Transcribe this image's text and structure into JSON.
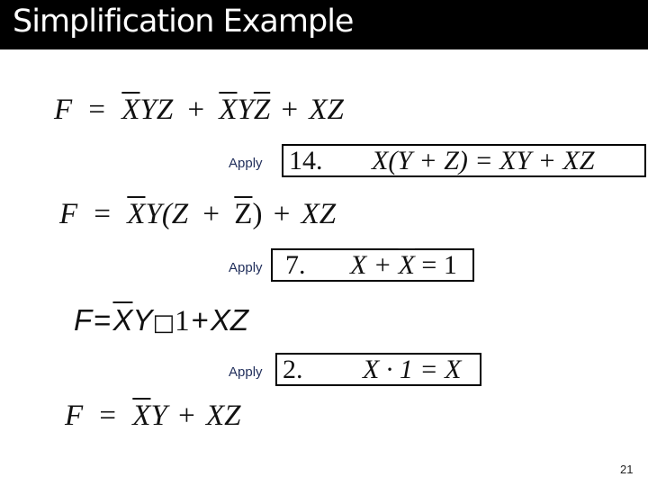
{
  "slide": {
    "title": "Simplification Example",
    "page_number": "21"
  },
  "steps": [
    {
      "equation": "F = X̄YZ + X̄YZ̄ + XZ",
      "lhs": "F",
      "eq": "=",
      "t1_over": "X",
      "t1_rest": "YZ",
      "plus1": "+",
      "t2_over": "X",
      "t2_mid": "Y",
      "t2_over2": "Z",
      "plus2": "+",
      "t3": "XZ"
    },
    {
      "apply_label": "Apply",
      "rule_number": "14.",
      "rule_formula": "X(Y + Z) = XY + XZ"
    },
    {
      "equation": "F = X̄Y(Z + Z̄) + XZ",
      "lhs": "F",
      "eq": "=",
      "t1_over": "X",
      "t1_rest": "Y(Z",
      "plus1": "+",
      "t2_over": "Z",
      "t2_rest": ")",
      "plus2": "+",
      "t3": "XZ"
    },
    {
      "apply_label": "Apply",
      "rule_number": "7.",
      "rule_formula_a": "X +",
      "rule_formula_over": "X",
      "rule_formula_b": "= 1"
    },
    {
      "equation": "F = X̄Y·1 + XZ",
      "lhs": "F",
      "eq": "=",
      "t1_over": "X",
      "t1_rest": "Y",
      "box_glyph": "□",
      "one": "1",
      "plus": "+",
      "t3": "XZ"
    },
    {
      "apply_label": "Apply",
      "rule_number": "2.",
      "rule_formula": "X · 1 = X"
    },
    {
      "equation": "F = X̄Y + XZ",
      "lhs": "F",
      "eq": "=",
      "t1_over": "X",
      "t1_rest": "Y",
      "plus": "+",
      "t3": "XZ"
    }
  ]
}
